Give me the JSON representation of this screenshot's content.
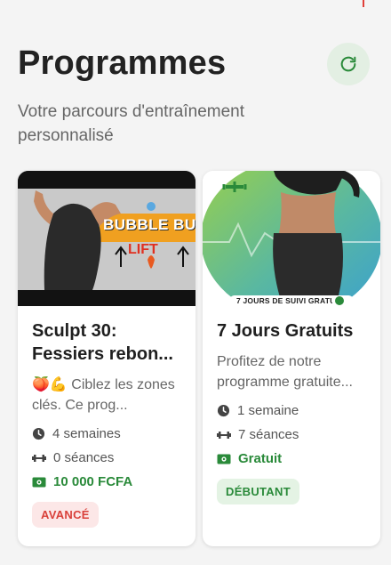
{
  "header": {
    "title": "Programmes",
    "subtitle": "Votre parcours d'entraînement personnalisé",
    "refresh_icon": "refresh-icon"
  },
  "programs": [
    {
      "thumb_text_line1": "BUBBLE BUTT",
      "thumb_text_line2": "LIFT",
      "title": "Sculpt 30: Fessiers rebon...",
      "description": "🍑💪 Ciblez les zones clés. Ce prog...",
      "duration": "4 semaines",
      "sessions": "0 séances",
      "price": "10 000 FCFA",
      "level": "AVANCÉ"
    },
    {
      "thumb_caption": "7 JOURS DE SUIVI GRATUIT",
      "title": "7 Jours Gratuits",
      "description": "Profitez de notre programme gratuite...",
      "duration": "1 semaine",
      "sessions": "7 séances",
      "price": "Gratuit",
      "level": "DÉBUTANT"
    }
  ],
  "colors": {
    "accent_green": "#2a8a3a",
    "advanced_red": "#d9403a"
  }
}
